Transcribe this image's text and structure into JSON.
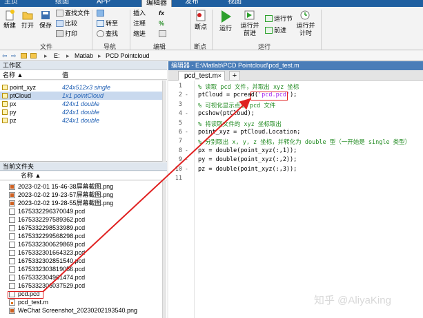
{
  "ribbon_tabs": [
    {
      "label": "主页"
    },
    {
      "label": "绘图"
    },
    {
      "label": "APP"
    },
    {
      "label": "编辑器"
    },
    {
      "label": "发布"
    },
    {
      "label": "视图"
    }
  ],
  "ribbon": {
    "new": "新建",
    "open": "打开",
    "save": "保存",
    "find_files": "查找文件",
    "compare": "比较",
    "print": "打印",
    "file_group": "文件",
    "goto": "转至",
    "find": "查找",
    "nav_group": "导航",
    "insert": "插入",
    "comment": "注释",
    "indent": "缩进",
    "fx": "fx",
    "edit_group": "编辑",
    "breakpoint": "断点",
    "breakpoint_group": "断点",
    "run": "运行",
    "run_advance": "运行并\n前进",
    "run_section": "运行节",
    "advance": "前进",
    "run_time": "运行并\n计时",
    "run_group": "运行"
  },
  "address": {
    "drive": "E:",
    "folder1": "Matlab",
    "folder2": "PCD Pointcloud"
  },
  "workspace": {
    "title": "工作区",
    "col_name": "名称 ▲",
    "col_value": "值",
    "rows": [
      {
        "name": "point_xyz",
        "value": "424x512x3 single"
      },
      {
        "name": "ptCloud",
        "value": "1x1 pointCloud"
      },
      {
        "name": "px",
        "value": "424x1 double"
      },
      {
        "name": "py",
        "value": "424x1 double"
      },
      {
        "name": "pz",
        "value": "424x1 double"
      }
    ]
  },
  "current_folder": {
    "title": "当前文件夹",
    "col_name": "名称 ▲",
    "files": [
      {
        "name": "2023-02-01 15-46-38屏幕截图.png",
        "type": "png"
      },
      {
        "name": "2023-02-02 19-23-57屏幕截图.png",
        "type": "png"
      },
      {
        "name": "2023-02-02 19-28-55屏幕截图.png",
        "type": "png"
      },
      {
        "name": "1675332296370049.pcd",
        "type": "pcd"
      },
      {
        "name": "1675332297589362.pcd",
        "type": "pcd"
      },
      {
        "name": "1675332298533989.pcd",
        "type": "pcd"
      },
      {
        "name": "1675332299568298.pcd",
        "type": "pcd"
      },
      {
        "name": "1675332300629869.pcd",
        "type": "pcd"
      },
      {
        "name": "1675332301664323.pcd",
        "type": "pcd"
      },
      {
        "name": "1675332302851540.pcd",
        "type": "pcd"
      },
      {
        "name": "1675332303819056.pcd",
        "type": "pcd"
      },
      {
        "name": "1675332304961474.pcd",
        "type": "pcd"
      },
      {
        "name": "1675332306037529.pcd",
        "type": "pcd"
      },
      {
        "name": "pcd.pcd",
        "type": "pcd"
      },
      {
        "name": "pcd_test.m",
        "type": "m"
      },
      {
        "name": "WeChat Screenshot_20230202193540.png",
        "type": "png"
      }
    ]
  },
  "editor": {
    "title": "编辑器 - E:\\Matlab\\PCD Pointcloud\\pcd_test.m",
    "tab": "pcd_test.m",
    "plus": "+",
    "lines": [
      {
        "n": "1",
        "mark": "",
        "pre": "% 读取 pcd 文件，并取出 xyz 坐标",
        "str": "",
        "post": "",
        "comment": true
      },
      {
        "n": "2",
        "mark": "-",
        "pre": "ptCloud = pcread(",
        "str": "'pcd.pcd'",
        "post": ");",
        "comment": false
      },
      {
        "n": "3",
        "mark": "",
        "pre": "% 可视化显示点云 pcd 文件",
        "str": "",
        "post": "",
        "comment": true
      },
      {
        "n": "4",
        "mark": "-",
        "pre": "pcshow(ptCloud);",
        "str": "",
        "post": "",
        "comment": false
      },
      {
        "n": "5",
        "mark": "",
        "pre": "% 将读取文件的 xyz 坐标取出",
        "str": "",
        "post": "",
        "comment": true
      },
      {
        "n": "6",
        "mark": "-",
        "pre": "point_xyz = ptCloud.Location;",
        "str": "",
        "post": "",
        "comment": false
      },
      {
        "n": "7",
        "mark": "",
        "pre": "% 分别取出 x, y, z 坐标，并转化为 double 型（一开始是 single 类型）",
        "str": "",
        "post": "",
        "comment": true
      },
      {
        "n": "8",
        "mark": "-",
        "pre": "px = double(point_xyz(:,1));",
        "str": "",
        "post": "",
        "comment": false
      },
      {
        "n": "9",
        "mark": "-",
        "pre": "py = double(point_xyz(:,2));",
        "str": "",
        "post": "",
        "comment": false
      },
      {
        "n": "10",
        "mark": "-",
        "pre": "pz = double(point_xyz(:,3));",
        "str": "",
        "post": "",
        "comment": false
      },
      {
        "n": "11",
        "mark": "",
        "pre": "",
        "str": "",
        "post": "",
        "comment": false
      }
    ]
  },
  "watermark": "知乎 @AliyaKing",
  "colors": {
    "accent": "#e02020",
    "title_bar": "#4a7db8",
    "comment": "#228b22",
    "string": "#a020f0"
  }
}
